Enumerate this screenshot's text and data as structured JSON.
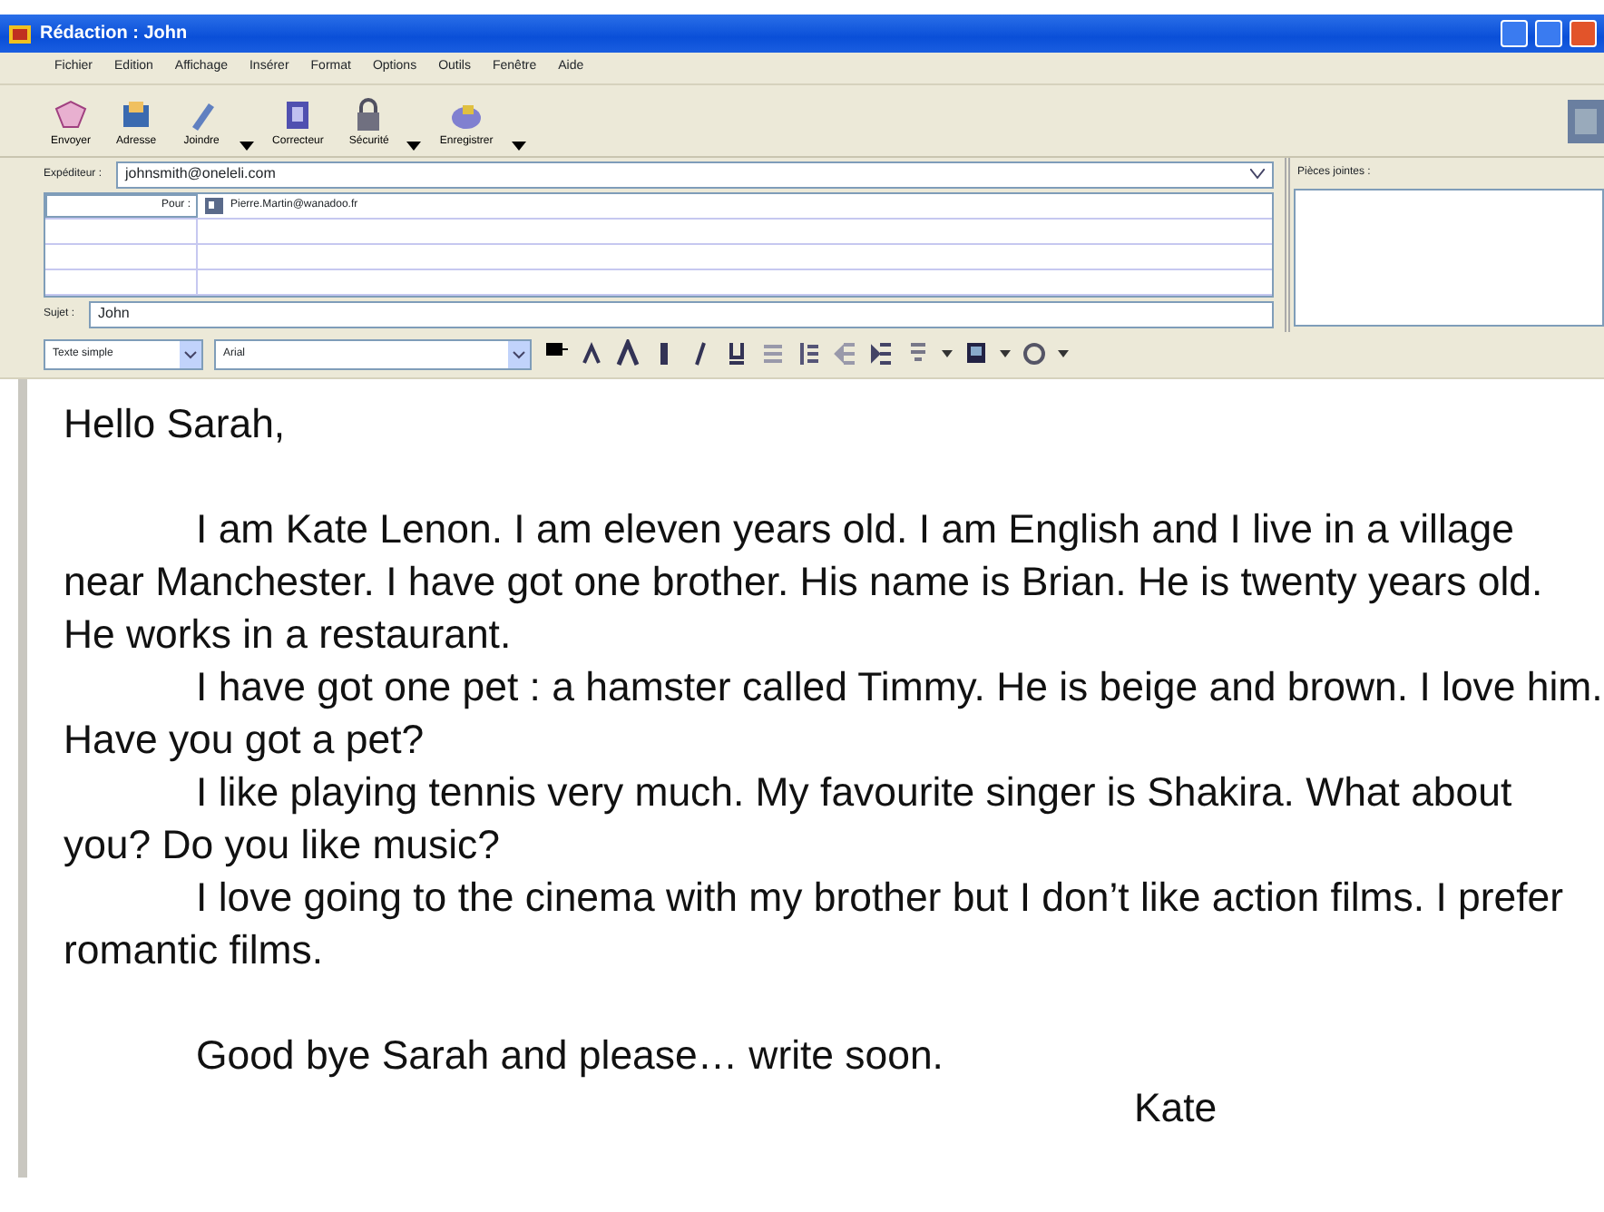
{
  "window": {
    "title": "Rédaction : John"
  },
  "menu": [
    "Fichier",
    "Edition",
    "Affichage",
    "Insérer",
    "Format",
    "Options",
    "Outils",
    "Fenêtre",
    "Aide"
  ],
  "toolbar": [
    {
      "label": "Envoyer",
      "kind": "send",
      "dropdown": false
    },
    {
      "label": "Adresse",
      "kind": "address",
      "dropdown": false
    },
    {
      "label": "Joindre",
      "kind": "attach",
      "dropdown": true
    },
    {
      "label": "Correcteur",
      "kind": "spell",
      "dropdown": false
    },
    {
      "label": "Sécurité",
      "kind": "lock",
      "dropdown": true
    },
    {
      "label": "Enregistrer",
      "kind": "save",
      "dropdown": true
    }
  ],
  "from": {
    "label": "Expéditeur :",
    "value": "johnsmith@oneleli.com"
  },
  "recipients": [
    {
      "field": "Pour :",
      "address": "Pierre.Martin@wanadoo.fr"
    }
  ],
  "subject": {
    "label": "Sujet :",
    "value": "John"
  },
  "attachments": {
    "label": "Pièces jointes :"
  },
  "format_bar": {
    "style": "Texte simple",
    "font": "Arial"
  },
  "body": {
    "greeting": "Hello Sarah,",
    "paragraphs": [
      "I am Kate Lenon. I am eleven years old. I am English and I live in a village near Manchester. I have got one brother. His name is Brian. He is twenty years old. He works in a restaurant.",
      "I have got one pet : a hamster called Timmy. He is beige and brown. I love him. Have you got a pet?",
      "I like playing tennis very much. My favourite singer is Shakira. What about you? Do you like music?",
      "I love going to the cinema with my brother but I don’t like action films. I prefer romantic films."
    ],
    "closing": "Good bye Sarah and please… write soon.",
    "signature": "Kate"
  }
}
